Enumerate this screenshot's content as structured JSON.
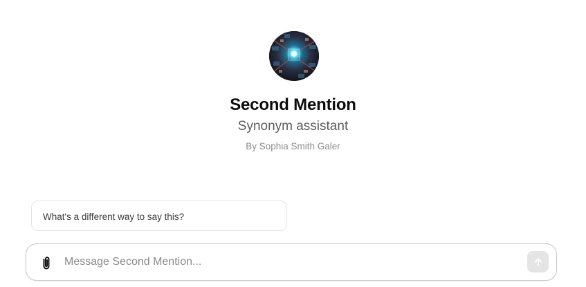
{
  "gpt": {
    "name": "Second Mention",
    "description": "Synonym assistant",
    "author": "By Sophia Smith Galer",
    "avatar_icon": "abstract-tunnel-avatar"
  },
  "conversation_starters": [
    {
      "text": "What's a different way to say this?"
    }
  ],
  "composer": {
    "placeholder": "Message Second Mention...",
    "value": "",
    "attach_icon": "paperclip-icon",
    "send_icon": "arrow-up-icon",
    "send_enabled": false
  },
  "colors": {
    "background": "#ffffff",
    "title": "#0d0d0d",
    "description": "#5d5d5d",
    "author": "#8e8e8e",
    "send_button_disabled": "#e5e5e5"
  }
}
